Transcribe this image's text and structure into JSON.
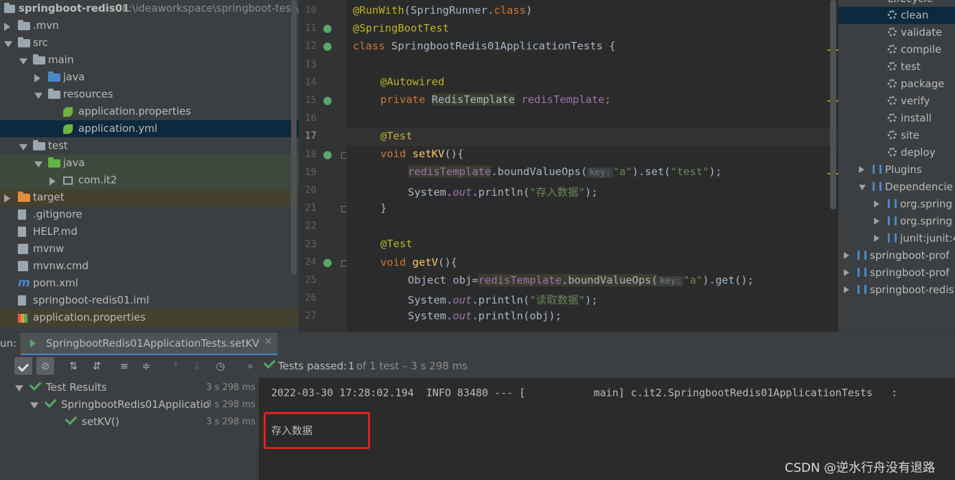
{
  "project": {
    "root_name": "springboot-redis01",
    "root_path": "E:\\ideaworkspace\\springboot-test\\",
    "items": [
      {
        "label": ".mvn",
        "indent": 0,
        "arrow": "right",
        "icon": "folder"
      },
      {
        "label": "src",
        "indent": 0,
        "arrow": "down",
        "icon": "folder"
      },
      {
        "label": "main",
        "indent": 1,
        "arrow": "down",
        "icon": "folder"
      },
      {
        "label": "java",
        "indent": 2,
        "arrow": "right",
        "icon": "folder-blue"
      },
      {
        "label": "resources",
        "indent": 2,
        "arrow": "down",
        "icon": "folder-res"
      },
      {
        "label": "application.properties",
        "indent": 3,
        "arrow": "",
        "icon": "spring-leaf"
      },
      {
        "label": "application.yml",
        "indent": 3,
        "arrow": "",
        "icon": "spring-leaf"
      },
      {
        "label": "test",
        "indent": 1,
        "arrow": "down",
        "icon": "folder"
      },
      {
        "label": "java",
        "indent": 2,
        "arrow": "down",
        "icon": "folder-green"
      },
      {
        "label": "com.it2",
        "indent": 3,
        "arrow": "right",
        "icon": "package"
      },
      {
        "label": "target",
        "indent": 0,
        "arrow": "right",
        "icon": "folder-orange"
      },
      {
        "label": ".gitignore",
        "indent": 0,
        "arrow": "",
        "icon": "file"
      },
      {
        "label": "HELP.md",
        "indent": 0,
        "arrow": "",
        "icon": "md-file"
      },
      {
        "label": "mvnw",
        "indent": 0,
        "arrow": "",
        "icon": "terminal-file"
      },
      {
        "label": "mvnw.cmd",
        "indent": 0,
        "arrow": "",
        "icon": "terminal-file"
      },
      {
        "label": "pom.xml",
        "indent": 0,
        "arrow": "",
        "icon": "maven-m"
      },
      {
        "label": "springboot-redis01.iml",
        "indent": 0,
        "arrow": "",
        "icon": "file"
      },
      {
        "label": "application.properties",
        "indent": 0,
        "arrow": "",
        "icon": "chart-file"
      }
    ]
  },
  "editor": {
    "line_numbers": [
      "10",
      "11",
      "12",
      "13",
      "14",
      "15",
      "16",
      "17",
      "18",
      "19",
      "20",
      "21",
      "22",
      "23",
      "24",
      "25",
      "26",
      "27"
    ],
    "code": {
      "l10a": "@RunWith",
      "l10b": "(SpringRunner.",
      "l10c": "class",
      "l10d": ")",
      "l11": "@SpringBootTest",
      "l12a": "class ",
      "l12b": "SpringbootRedis01ApplicationTests {",
      "l14": "@Autowired",
      "l15a": "private ",
      "l15b": "RedisTemplate",
      "l15c": " ",
      "l15d": "redisTemplate",
      ";": ";",
      "l17": "@Test",
      "l18a": "void ",
      "l18b": "setKV",
      "l18c": "(){",
      "l19a": "redisTemplate",
      "l19b": ".boundValueOps(",
      "l19hint": "key:",
      "l19c": "\"a\"",
      "l19d": ").set(",
      "l19e": "\"test\"",
      "l19f": ");",
      "l20a": "System.",
      "l20b": "out",
      "l20c": ".println(",
      "l20d": "\"存入数据\"",
      "l20e": ");",
      "l21": "}",
      "l23": "@Test",
      "l24a": "void ",
      "l24b": "getV",
      "l24c": "(){",
      "l25a": "Object obj=",
      "l25b": "redisTemplate",
      "l25c": ".boundValueOps(",
      "l25hint": "key:",
      "l25d": "\"a\"",
      "l25e": ").get();",
      "l26a": "System.",
      "l26b": "out",
      "l26c": ".println(",
      "l26d": "\"读取数据\"",
      "l26e": ");",
      "l27a": "System.",
      "l27b": "out",
      "l27c": ".println(obj);"
    }
  },
  "maven": {
    "lifecycle_partial": "Lifecycle",
    "goals": [
      "clean",
      "validate",
      "compile",
      "test",
      "package",
      "verify",
      "install",
      "site",
      "deploy"
    ],
    "plugins": "Plugins",
    "dependencies": "Dependencie",
    "deps": [
      "org.spring",
      "org.spring",
      "junit:junit:4"
    ],
    "projects": [
      "springboot-prof",
      "springboot-prof",
      "springboot-redis"
    ]
  },
  "run": {
    "label": "un:",
    "tab_title": "SpringbootRedis01ApplicationTests.setKV",
    "status_prefix": "Tests passed:",
    "status_count": "1",
    "status_rest": "of 1 test – 3 s 298 ms",
    "tree": [
      {
        "label": "Test Results",
        "time": "3 s 298 ms",
        "indent": 0
      },
      {
        "label": "SpringbootRedis01Applicatio",
        "time": "3 s 298 ms",
        "indent": 1
      },
      {
        "label": "setKV()",
        "time": "3 s 298 ms",
        "indent": 2
      }
    ],
    "console": {
      "log_line": "2022-03-30 17:28:02.194  INFO 83480 --- [           main] c.it2.SpringbootRedis01ApplicationTests   :",
      "output": "存入数据",
      "watermark": "CSDN @逆水行舟没有退路"
    }
  }
}
